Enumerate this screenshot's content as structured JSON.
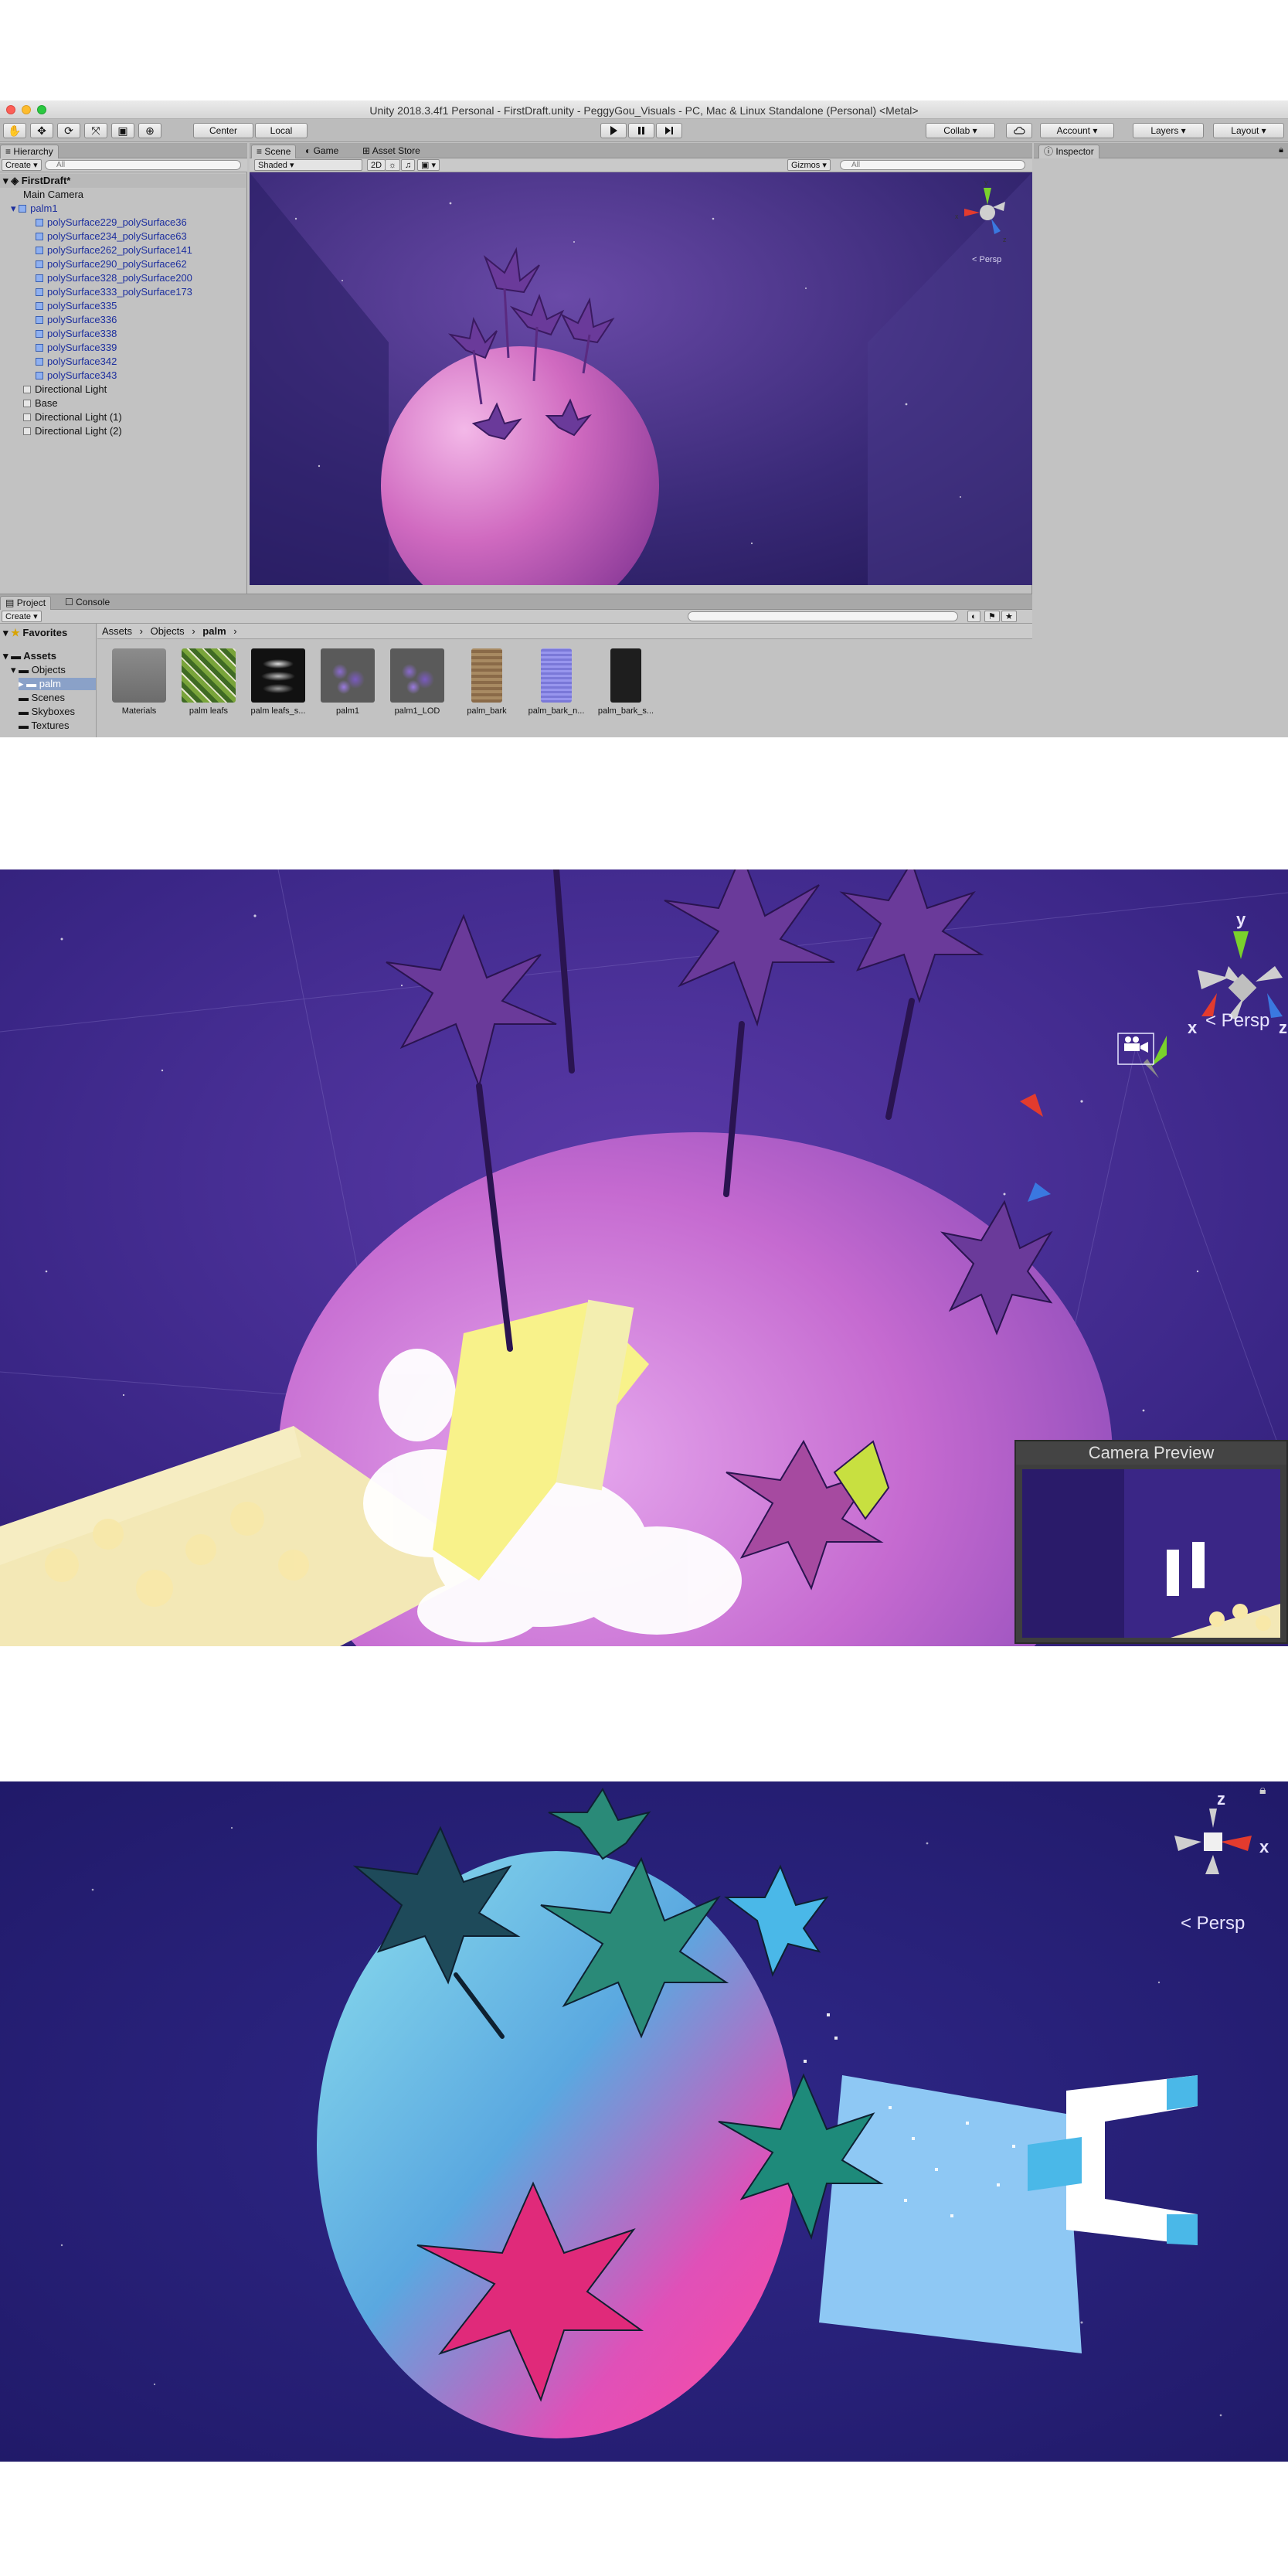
{
  "window": {
    "title": "Unity 2018.3.4f1 Personal - FirstDraft.unity - PeggyGou_Visuals - PC, Mac & Linux Standalone (Personal) <Metal>"
  },
  "toolbar": {
    "pivot_label": "Center",
    "space_label": "Local",
    "collab_label": "Collab ▾",
    "account_label": "Account ▾",
    "layers_label": "Layers ▾",
    "layout_label": "Layout ▾"
  },
  "hierarchy": {
    "tab_label": "Hierarchy",
    "create_label": "Create ▾",
    "search_placeholder": "All",
    "scene_name": "FirstDraft*",
    "items": [
      {
        "label": "Main Camera"
      },
      {
        "label": "palm1"
      },
      {
        "label": "polySurface229_polySurface36"
      },
      {
        "label": "polySurface234_polySurface63"
      },
      {
        "label": "polySurface262_polySurface141"
      },
      {
        "label": "polySurface290_polySurface62"
      },
      {
        "label": "polySurface328_polySurface200"
      },
      {
        "label": "polySurface333_polySurface173"
      },
      {
        "label": "polySurface335"
      },
      {
        "label": "polySurface336"
      },
      {
        "label": "polySurface338"
      },
      {
        "label": "polySurface339"
      },
      {
        "label": "polySurface342"
      },
      {
        "label": "polySurface343"
      },
      {
        "label": "Directional Light"
      },
      {
        "label": "Base"
      },
      {
        "label": "Directional Light (1)"
      },
      {
        "label": "Directional Light (2)"
      }
    ]
  },
  "scene_panel": {
    "tabs": [
      "Scene",
      "Game",
      "Asset Store"
    ],
    "shading_mode": "Shaded",
    "mode_2d": "2D",
    "gizmos_label": "Gizmos ▾",
    "search_placeholder": "All",
    "persp_label": "< Persp"
  },
  "inspector": {
    "tab_label": "Inspector"
  },
  "project": {
    "tabs": [
      "Project",
      "Console"
    ],
    "create_label": "Create ▾",
    "favorites_label": "Favorites",
    "tree": [
      "Assets",
      "Objects",
      "palm",
      "Scenes",
      "Skyboxes",
      "Textures"
    ],
    "breadcrumb": [
      "Assets",
      "Objects",
      "palm"
    ],
    "assets": [
      {
        "label": "Materials"
      },
      {
        "label": "palm leafs"
      },
      {
        "label": "palm leafs_s..."
      },
      {
        "label": "palm1"
      },
      {
        "label": "palm1_LOD"
      },
      {
        "label": "palm_bark"
      },
      {
        "label": "palm_bark_n..."
      },
      {
        "label": "palm_bark_s..."
      }
    ]
  },
  "scene2": {
    "axis_labels": {
      "y": "y",
      "x": "x",
      "z": "z"
    },
    "persp_label": "< Persp",
    "camera_preview_title": "Camera Preview"
  },
  "scene3": {
    "axis_labels": {
      "z": "z",
      "x": "x"
    },
    "persp_label": "< Persp"
  }
}
